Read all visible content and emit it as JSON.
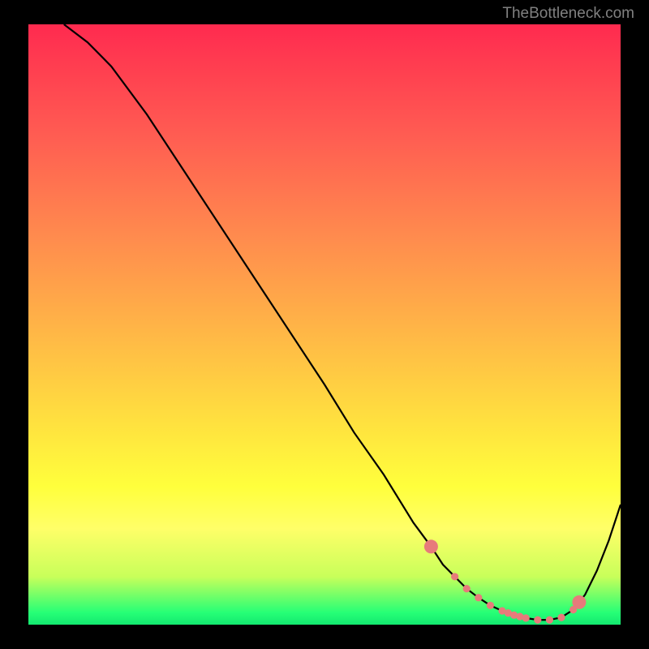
{
  "watermark": "TheBottleneck.com",
  "chart_data": {
    "type": "line",
    "title": "",
    "xlabel": "",
    "ylabel": "",
    "xlim": [
      0,
      100
    ],
    "ylim": [
      0,
      100
    ],
    "series": [
      {
        "name": "curve",
        "x": [
          6,
          10,
          14,
          20,
          30,
          40,
          50,
          55,
          60,
          65,
          68,
          70,
          72,
          74,
          76,
          78,
          80,
          82,
          84,
          86,
          88,
          90,
          92,
          94,
          96,
          98,
          100
        ],
        "y": [
          100,
          97,
          93,
          85,
          70,
          55,
          40,
          32,
          25,
          17,
          13,
          10,
          8,
          6,
          4.5,
          3.2,
          2.3,
          1.6,
          1.1,
          0.8,
          0.8,
          1.2,
          2.5,
          5,
          9,
          14,
          20
        ]
      }
    ],
    "markers": {
      "name": "highlight-points",
      "color": "#e77b7b",
      "large_x": [
        68,
        93
      ],
      "small_x": [
        72,
        74,
        76,
        78,
        80,
        81,
        82,
        83,
        84,
        86,
        88,
        90,
        92
      ]
    },
    "gradient_colors": {
      "top": "#ff2a4f",
      "mid": "#ffe03f",
      "bottom": "#13e870"
    }
  }
}
